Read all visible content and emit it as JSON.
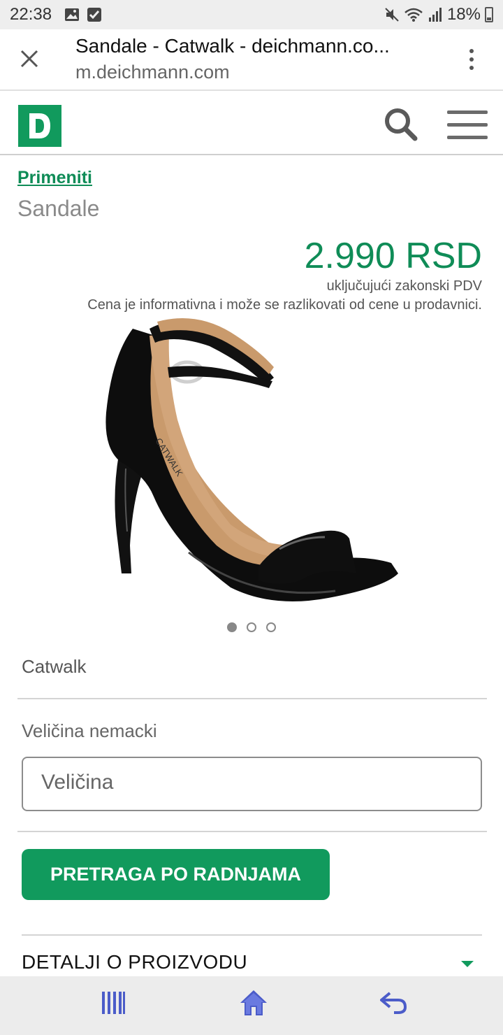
{
  "status_bar": {
    "time": "22:38",
    "battery": "18%"
  },
  "browser": {
    "page_title": "Sandale - Catwalk - deichmann.co...",
    "url": "m.deichmann.com"
  },
  "site": {
    "logo_letter": "D",
    "brand_color": "#119a5d"
  },
  "product": {
    "breadcrumb": "Primeniti",
    "type": "Sandale",
    "price": "2.990 RSD",
    "vat_note": "uključujući zakonski PDV",
    "price_disclaimer": "Cena je informativna i može se razlikovati od cene u prodavnici.",
    "image_text": "CATWALK",
    "carousel": {
      "active": 1,
      "total": 3
    },
    "brand": "Catwalk",
    "size_label": "Veličina nemacki",
    "size_placeholder": "Veličina",
    "store_search_button": "PRETRAGA PO RADNJAMA",
    "details_label": "DETALJI O PROIZVODU"
  }
}
